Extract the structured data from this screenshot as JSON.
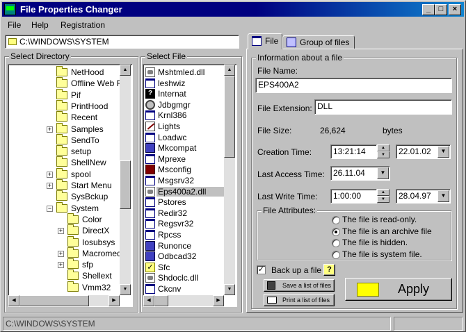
{
  "app": {
    "title": "File Properties Changer",
    "controls": {
      "minimize": "_",
      "maximize": "□",
      "close": "×"
    }
  },
  "menu": {
    "items": [
      {
        "label": "File"
      },
      {
        "label": "Help"
      },
      {
        "label": "Registration"
      }
    ]
  },
  "path": {
    "value": "C:\\WINDOWS\\SYSTEM"
  },
  "directory": {
    "title": "Select Directory",
    "items": [
      {
        "label": "NetHood",
        "expander": false
      },
      {
        "label": "Offline Web F",
        "expander": false
      },
      {
        "label": "Pif",
        "expander": false
      },
      {
        "label": "PrintHood",
        "expander": false
      },
      {
        "label": "Recent",
        "expander": false
      },
      {
        "label": "Samples",
        "expander": true
      },
      {
        "label": "SendTo",
        "expander": false
      },
      {
        "label": "setup",
        "expander": false
      },
      {
        "label": "ShellNew",
        "expander": false
      },
      {
        "label": "spool",
        "expander": true
      },
      {
        "label": "Start Menu",
        "expander": true
      },
      {
        "label": "SysBckup",
        "expander": false
      },
      {
        "label": "System",
        "expander": true
      },
      {
        "label": "Color",
        "expander": false,
        "child": true
      },
      {
        "label": "DirectX",
        "expander": true,
        "child": true
      },
      {
        "label": "Iosubsys",
        "expander": false,
        "child": true
      },
      {
        "label": "Macromed",
        "expander": true,
        "child": true
      },
      {
        "label": "sfp",
        "expander": true,
        "child": true
      },
      {
        "label": "Shellext",
        "expander": false,
        "child": true
      },
      {
        "label": "Vmm32",
        "expander": false,
        "child": true
      }
    ]
  },
  "files": {
    "title": "Select File",
    "items": [
      {
        "label": "Mshtmled.dll",
        "icon": "dll-file-icon"
      },
      {
        "label": "leshwiz",
        "icon": "app-file-icon"
      },
      {
        "label": "Internat",
        "icon": "unknown-file-icon"
      },
      {
        "label": "Jdbgmgr",
        "icon": "gear-file-icon"
      },
      {
        "label": "Krnl386",
        "icon": "window-file-icon"
      },
      {
        "label": "Lights",
        "icon": "pen-file-icon"
      },
      {
        "label": "Loadwc",
        "icon": "window-file-icon"
      },
      {
        "label": "Mkcompat",
        "icon": "net-file-icon"
      },
      {
        "label": "Mprexe",
        "icon": "window-file-icon"
      },
      {
        "label": "Msconfig",
        "icon": "config-file-icon"
      },
      {
        "label": "Msgsrv32",
        "icon": "window-file-icon"
      },
      {
        "label": "Eps400a2.dll",
        "icon": "dll-file-icon",
        "selected": true
      },
      {
        "label": "Pstores",
        "icon": "window-file-icon"
      },
      {
        "label": "Redir32",
        "icon": "window-file-icon"
      },
      {
        "label": "Regsvr32",
        "icon": "window-file-icon"
      },
      {
        "label": "Rpcss",
        "icon": "window-file-icon"
      },
      {
        "label": "Runonce",
        "icon": "net-file-icon"
      },
      {
        "label": "Odbcad32",
        "icon": "net-file-icon"
      },
      {
        "label": "Sfc",
        "icon": "check-file-icon"
      },
      {
        "label": "Shdoclc.dll",
        "icon": "dll-file-icon"
      },
      {
        "label": "Ckcnv",
        "icon": "window-file-icon"
      }
    ]
  },
  "tabs": [
    {
      "label": "File",
      "active": true
    },
    {
      "label": "Group of files",
      "active": false
    }
  ],
  "info": {
    "title": "Information about a file",
    "file_name_label": "File Name:",
    "file_name": "EPS400A2",
    "extension_label": "File Extension:",
    "extension": "DLL",
    "size_label": "File Size:",
    "size_value": "26,624",
    "size_unit": "bytes",
    "creation_label": "Creation Time:",
    "creation_time": "13:21:14",
    "creation_date": "22.01.02",
    "access_label": "Last Access Time:",
    "access_date": "26.11.04",
    "write_label": "Last Write Time:",
    "write_time": "1:00:00",
    "write_date": "28.04.97"
  },
  "attributes": {
    "title": "File Attributes:",
    "options": [
      {
        "label": "The file is read-only.",
        "checked": false
      },
      {
        "label": "The file is an archive file",
        "checked": true
      },
      {
        "label": "The file is hidden.",
        "checked": false
      },
      {
        "label": "The file is system file.",
        "checked": false
      }
    ]
  },
  "backup": {
    "label": "Back up a file",
    "checked": true,
    "help": "?"
  },
  "buttons": {
    "save_list": "Save a list of files",
    "print_list": "Print a list of files",
    "apply": "Apply"
  },
  "status": {
    "path": "C:\\WINDOWS\\SYSTEM"
  }
}
